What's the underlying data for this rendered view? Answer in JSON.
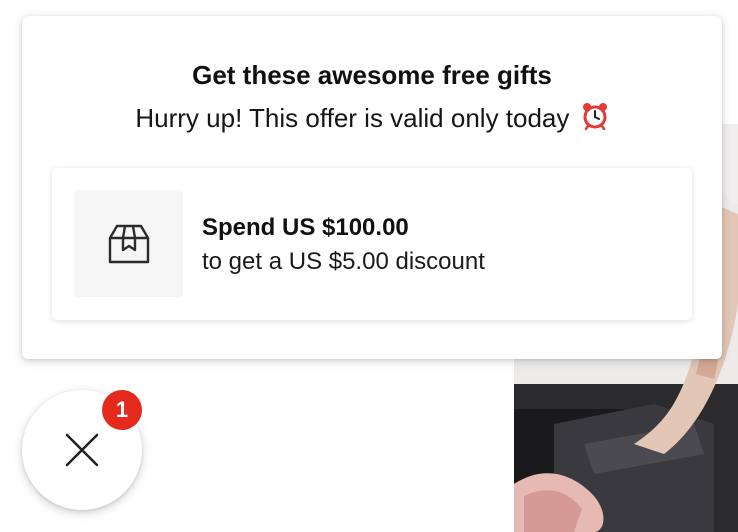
{
  "popup": {
    "title": "Get these awesome free gifts",
    "subtitle": "Hurry up! This offer is valid only today",
    "subtitle_icon": "alarm-clock-icon"
  },
  "offer": {
    "icon": "gift-box-icon",
    "amount": "Spend US $100.00",
    "description": "to get a US $5.00 discount"
  },
  "fab": {
    "icon": "close-icon",
    "badge_count": "1",
    "badge_color": "#e32a1c"
  }
}
